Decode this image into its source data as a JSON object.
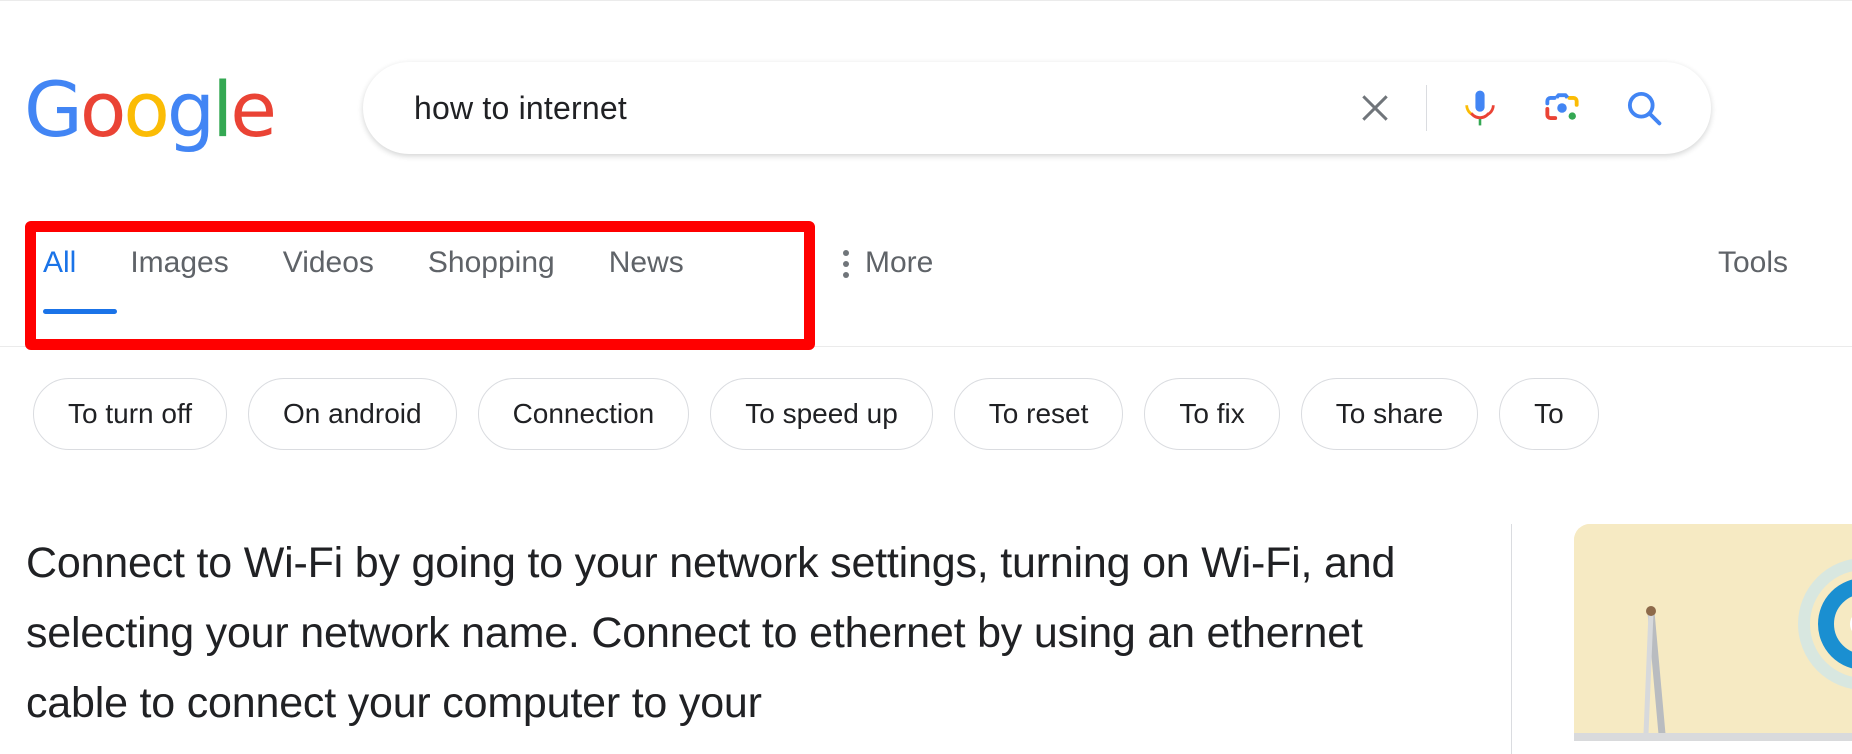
{
  "brand": {
    "name": "Google",
    "letters": [
      {
        "char": "G",
        "color": "#4285F4"
      },
      {
        "char": "o",
        "color": "#EA4335"
      },
      {
        "char": "o",
        "color": "#FBBC05"
      },
      {
        "char": "g",
        "color": "#4285F4"
      },
      {
        "char": "l",
        "color": "#34A853"
      },
      {
        "char": "e",
        "color": "#EA4335"
      }
    ]
  },
  "search": {
    "query": "how to internet",
    "placeholder": "Search Google or type a URL",
    "clear_icon": "close-icon",
    "voice_icon": "microphone-icon",
    "lens_icon": "google-lens-icon",
    "search_icon": "search-icon"
  },
  "nav": {
    "tabs": [
      {
        "label": "All",
        "active": true
      },
      {
        "label": "Images",
        "active": false
      },
      {
        "label": "Videos",
        "active": false
      },
      {
        "label": "Shopping",
        "active": false
      },
      {
        "label": "News",
        "active": false
      }
    ],
    "more_label": "More",
    "more_icon": "overflow-dots-icon",
    "tools_label": "Tools",
    "active_color": "#1a73e8",
    "inactive_color": "#5f6368"
  },
  "annotation": {
    "color": "#ff0000",
    "target": "search-tabs-navigation"
  },
  "chips": [
    {
      "label": "To turn off"
    },
    {
      "label": "On android"
    },
    {
      "label": "Connection"
    },
    {
      "label": "To speed up"
    },
    {
      "label": "To reset"
    },
    {
      "label": "To fix"
    },
    {
      "label": "To share"
    },
    {
      "label": "To"
    }
  ],
  "main": {
    "answer": "Connect to Wi-Fi by going to your network settings, turning on Wi-Fi, and selecting your network name. Connect to ethernet by using an ethernet cable to connect your computer to your",
    "thumbnail_alt": "wifi-router-illustration",
    "thumbnail_bg": "#f6eac3"
  }
}
